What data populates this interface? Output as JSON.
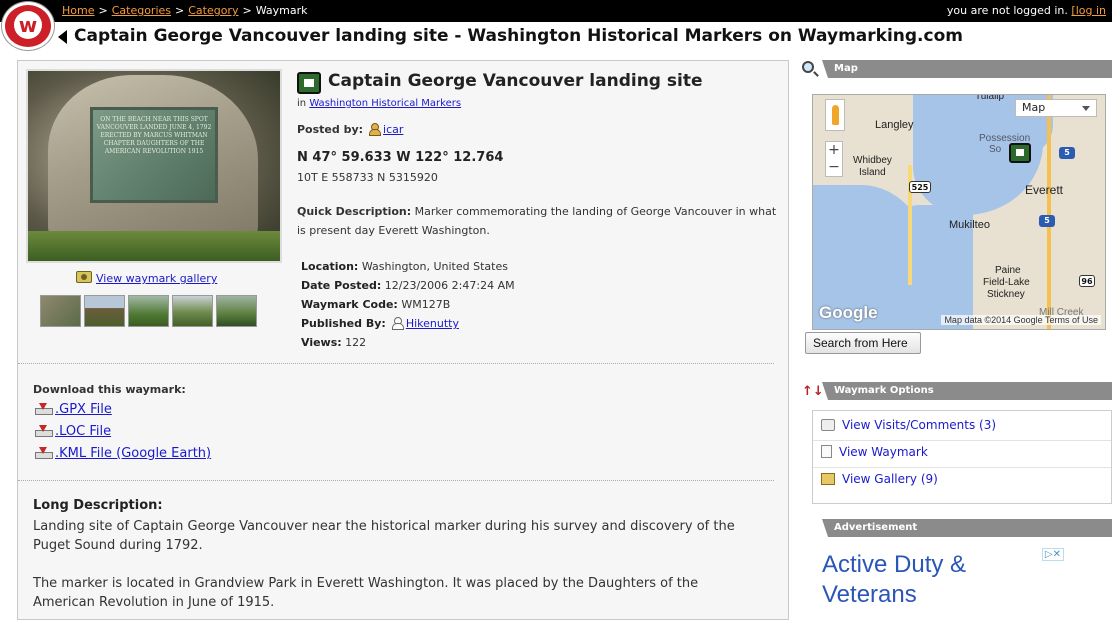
{
  "header": {
    "breadcrumb": {
      "home": "Home",
      "categories": "Categories",
      "category": "Category",
      "current": "Waymark"
    },
    "login_text": "you are not logged in.",
    "login_link": "[log in",
    "page_title": "Captain George Vancouver landing site - Washington Historical Markers on Waymarking.com"
  },
  "waymark": {
    "title": "Captain George Vancouver landing site",
    "in_label": "in",
    "category": "Washington Historical Markers",
    "posted_by_label": "Posted by:",
    "posted_by": "icar",
    "coords": "N 47° 59.633 W 122° 12.764",
    "utm": "10T E 558733 N 5315920",
    "quick_label": "Quick Description:",
    "quick_desc": "Marker commemorating the landing of George Vancouver in what is present day Everett Washington.",
    "location_label": "Location:",
    "location": "Washington, United States",
    "date_label": "Date Posted:",
    "date": "12/23/2006 2:47:24 AM",
    "code_label": "Waymark Code:",
    "code": "WM127B",
    "published_label": "Published By:",
    "published_by": "Hikenutty",
    "views_label": "Views:",
    "views": "122",
    "gallery_link": "View waymark gallery",
    "plaque_text": "ON THE BEACH NEAR THIS SPOT VANCOUVER LANDED JUNE 4, 1792 ERECTED BY MARCUS WHITMAN CHAPTER DAUGHTERS OF THE AMERICAN REVOLUTION 1915"
  },
  "download": {
    "title": "Download this waymark:",
    "gpx": ".GPX File",
    "loc": ".LOC File",
    "kml": ".KML File (Google Earth)"
  },
  "long_description": {
    "title": "Long Description:",
    "p1": "Landing site of Captain George Vancouver near the historical marker during his survey and discovery of the Puget Sound during 1792.",
    "p2": "The marker is located in Grandview Park in Everett Washington. It was placed by the Daughters of the American Revolution in June of 1915."
  },
  "map": {
    "title": "Map",
    "type_select": "Map",
    "zoom_in": "+",
    "zoom_out": "−",
    "labels": {
      "tulalip": "Tulalip",
      "langley": "Langley",
      "possession": "Possession",
      "possession_so": "So",
      "whidbey": "Whidbey",
      "island": "Island",
      "everett": "Everett",
      "mukilteo": "Mukilteo",
      "paine": "Paine",
      "field_lake": "Field-Lake",
      "stickney": "Stickney",
      "mill_creek": "Mill Creek"
    },
    "shields": {
      "i5_a": "5",
      "i5_b": "5",
      "sr525": "525",
      "sr96": "96"
    },
    "logo": "Google",
    "credit": "Map data ©2014 Google   Terms of Use",
    "search_button": "Search from Here"
  },
  "options": {
    "title": "Waymark Options",
    "visits": "View Visits/Comments (3)",
    "waymark": "View Waymark",
    "gallery": "View Gallery (9)"
  },
  "ad": {
    "title": "Advertisement",
    "text_line1": "Active Duty &",
    "text_line2": "Veterans",
    "close": "▷✕"
  }
}
